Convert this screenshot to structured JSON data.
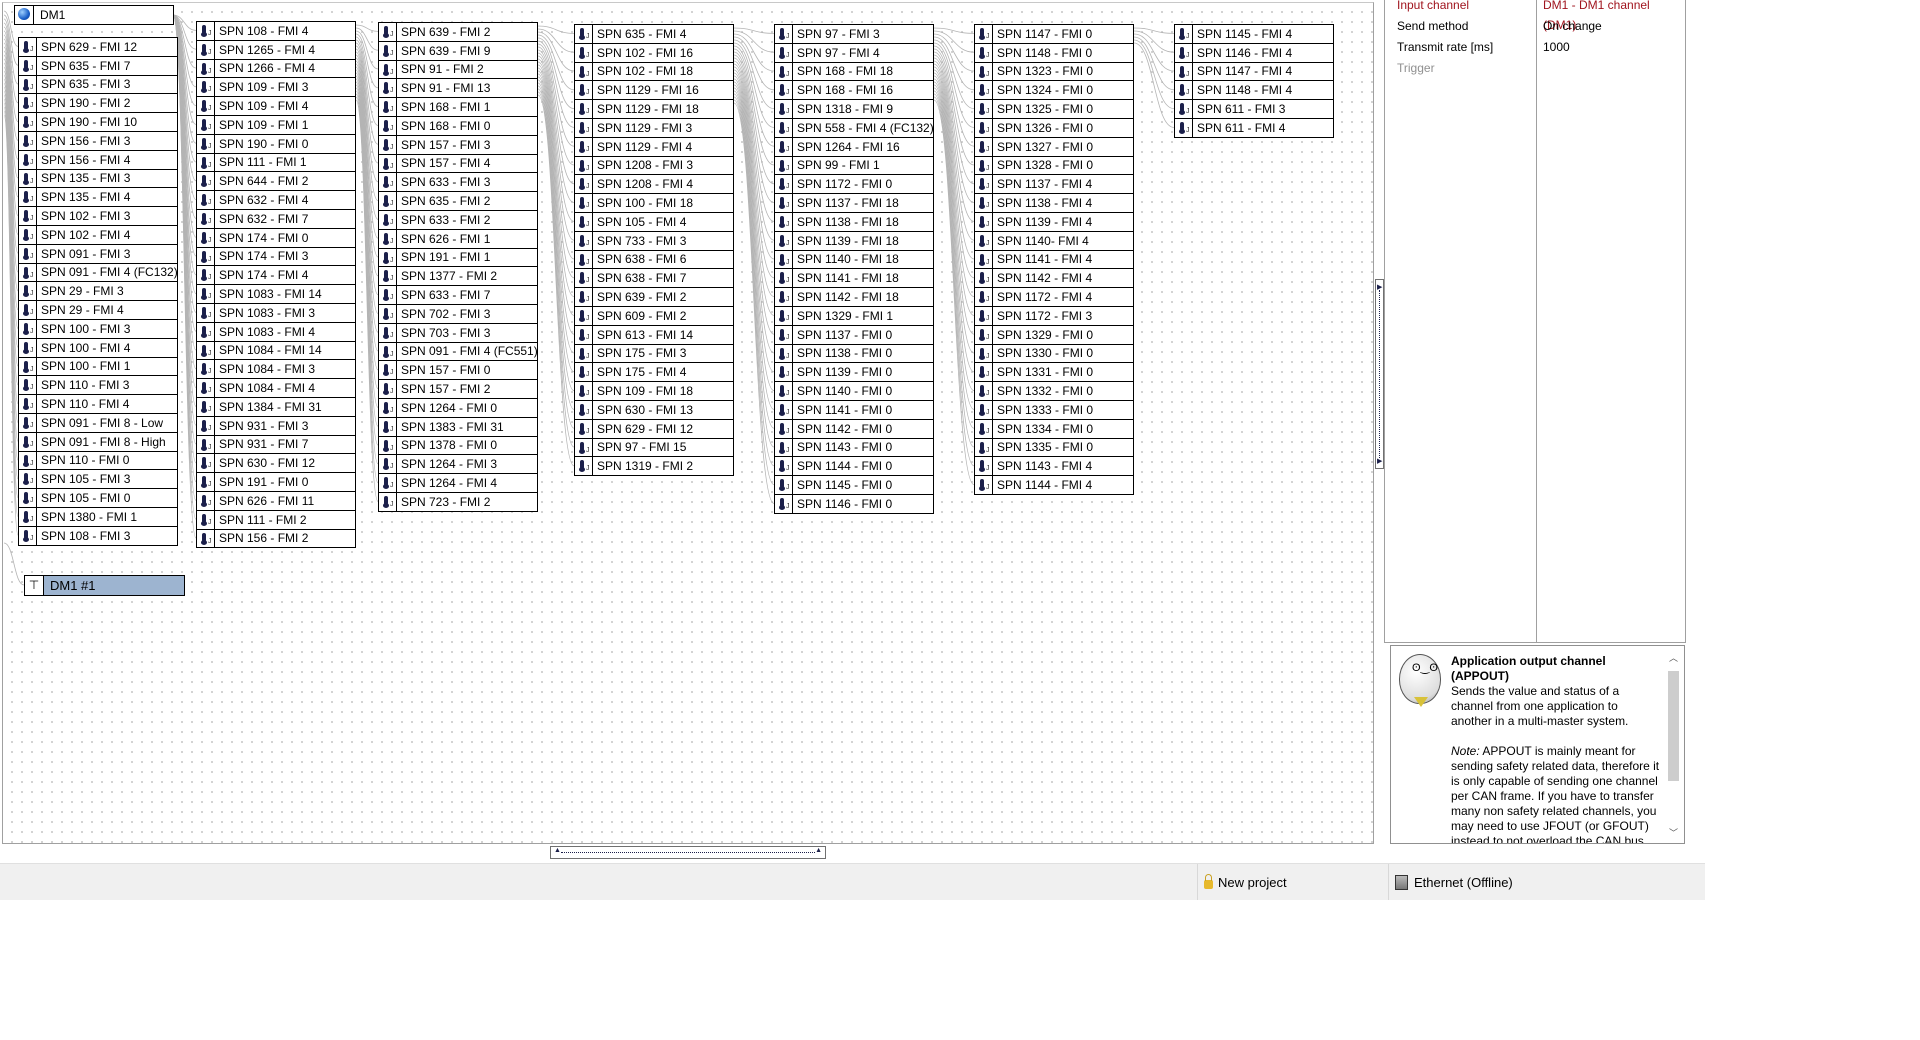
{
  "source_node": {
    "label": "DM1",
    "icon": "globe-icon"
  },
  "output_node": {
    "label": "DM1 #1",
    "icon": "output-icon"
  },
  "item_icon": "thermometer-icon",
  "columns": [
    [
      "SPN 629 - FMI 12",
      "SPN 635 - FMI 7",
      "SPN 635 - FMI 3",
      "SPN 190 - FMI 2",
      "SPN 190 - FMI 10",
      "SPN 156 - FMI 3",
      "SPN 156 - FMI 4",
      "SPN 135 - FMI 3",
      "SPN 135 - FMI 4",
      "SPN 102 - FMI 3",
      "SPN 102 - FMI 4",
      "SPN 091 - FMI 3",
      "SPN 091 - FMI 4 (FC132)",
      "SPN 29 - FMI 3",
      "SPN 29 - FMI 4",
      "SPN 100 - FMI 3",
      "SPN 100 - FMI 4",
      "SPN 100 - FMI 1",
      "SPN 110 - FMI 3",
      "SPN 110 - FMI 4",
      "SPN 091 - FMI 8 - Low",
      "SPN 091 - FMI 8 - High",
      "SPN 110 - FMI 0",
      "SPN 105 - FMI 3",
      "SPN 105 - FMI 0",
      "SPN 1380 - FMI 1",
      "SPN 108 - FMI 3"
    ],
    [
      "SPN 108 - FMI 4",
      "SPN 1265 - FMI 4",
      "SPN 1266 - FMI 4",
      "SPN 109 - FMI 3",
      "SPN 109 - FMI 4",
      "SPN 109 - FMI 1",
      "SPN 190 - FMI 0",
      "SPN 111 - FMI 1",
      "SPN 644 - FMI 2",
      "SPN 632 - FMI 4",
      "SPN 632 - FMI 7",
      "SPN 174 - FMI 0",
      "SPN 174 - FMI 3",
      "SPN 174 - FMI 4",
      "SPN 1083 - FMI 14",
      "SPN 1083 - FMI 3",
      "SPN 1083 - FMI 4",
      "SPN 1084 - FMI 14",
      "SPN 1084 - FMI 3",
      "SPN 1084 - FMI 4",
      "SPN 1384 - FMI 31",
      "SPN 931 - FMI 3",
      "SPN 931 - FMI 7",
      "SPN 630 - FMI 12",
      "SPN 191 - FMI 0",
      "SPN 626 - FMI 11",
      "SPN 111 - FMI 2",
      "SPN 156 - FMI 2"
    ],
    [
      "SPN 639 - FMI 2",
      "SPN 639 - FMI 9",
      "SPN 91 - FMI 2",
      "SPN 91 - FMI 13",
      "SPN 168 - FMI 1",
      "SPN 168 - FMI 0",
      "SPN 157 - FMI 3",
      "SPN 157 - FMI 4",
      "SPN 633 - FMI 3",
      "SPN 635 - FMI 2",
      "SPN 633 - FMI 2",
      "SPN 626 - FMI 1",
      "SPN 191 - FMI 1",
      "SPN 1377 - FMI 2",
      "SPN 633 - FMI 7",
      "SPN 702 - FMI 3",
      "SPN 703 - FMI 3",
      "SPN 091 - FMI 4 (FC551)",
      "SPN 157 - FMI 0",
      "SPN 157 - FMI 2",
      "SPN 1264 - FMI 0",
      "SPN 1383 - FMI 31",
      "SPN 1378 - FMI 0",
      "SPN 1264 - FMI 3",
      "SPN 1264 - FMI 4",
      "SPN 723 - FMI 2"
    ],
    [
      "SPN 635 - FMI 4",
      "SPN 102 - FMI 16",
      "SPN 102 - FMI 18",
      "SPN 1129 - FMI 16",
      "SPN 1129 - FMI 18",
      "SPN 1129 - FMI 3",
      "SPN 1129 - FMI 4",
      "SPN 1208 - FMI 3",
      "SPN 1208 - FMI 4",
      "SPN 100 - FMI 18",
      "SPN 105 - FMI 4",
      "SPN 733 - FMI 3",
      "SPN 638 - FMI 6",
      "SPN 638 - FMI 7",
      "SPN 639 - FMI 2",
      "SPN 609 - FMI 2",
      "SPN 613 - FMI 14",
      "SPN 175 - FMI 3",
      "SPN 175 - FMI 4",
      "SPN 109 - FMI 18",
      "SPN 630 - FMI 13",
      "SPN 629 - FMI 12",
      "SPN 97 - FMI 15",
      "SPN 1319 - FMI 2"
    ],
    [
      "SPN 97 - FMI 3",
      "SPN 97 - FMI 4",
      "SPN 168 - FMI 18",
      "SPN 168 - FMI 16",
      "SPN 1318 - FMI 9",
      "SPN 558 - FMI 4 (FC132)",
      "SPN 1264 - FMI 16",
      "SPN 99 - FMI 1",
      "SPN 1172 - FMI 0",
      "SPN 1137 - FMI 18",
      "SPN 1138 - FMI 18",
      "SPN 1139 - FMI 18",
      "SPN 1140 - FMI 18",
      "SPN 1141 - FMI 18",
      "SPN 1142 - FMI 18",
      "SPN 1329 - FMI 1",
      "SPN 1137 - FMI 0",
      "SPN 1138 - FMI 0",
      "SPN 1139 - FMI 0",
      "SPN 1140 - FMI 0",
      "SPN 1141 - FMI 0",
      "SPN 1142 - FMI 0",
      "SPN 1143 - FMI 0",
      "SPN 1144 - FMI 0",
      "SPN 1145 - FMI 0",
      "SPN 1146 - FMI 0"
    ],
    [
      "SPN 1147 - FMI 0",
      "SPN 1148 - FMI 0",
      "SPN 1323 - FMI 0",
      "SPN 1324 - FMI 0",
      "SPN 1325 - FMI 0",
      "SPN 1326 - FMI 0",
      "SPN 1327 - FMI 0",
      "SPN 1328 - FMI 0",
      "SPN 1137 - FMI 4",
      "SPN 1138 - FMI 4",
      "SPN 1139 - FMI 4",
      "SPN 1140- FMI 4",
      "SPN 1141 - FMI 4",
      "SPN 1142 - FMI 4",
      "SPN 1172 - FMI 4",
      "SPN 1172 - FMI 3",
      "SPN 1329 - FMI 0",
      "SPN 1330 - FMI 0",
      "SPN 1331 - FMI 0",
      "SPN 1332 - FMI 0",
      "SPN 1333 - FMI 0",
      "SPN 1334 - FMI 0",
      "SPN 1335 - FMI 0",
      "SPN 1143 - FMI 4",
      "SPN 1144 - FMI 4"
    ],
    [
      "SPN 1145 - FMI 4",
      "SPN 1146 - FMI 4",
      "SPN 1147 - FMI 4",
      "SPN 1148 - FMI 4",
      "SPN 611 - FMI 3",
      "SPN 611 - FMI 4"
    ]
  ],
  "properties": [
    {
      "key": "Input channel",
      "value": "DM1 - DM1 channel (DM1)",
      "state": "error"
    },
    {
      "key": "Send method",
      "value": "On change",
      "state": "normal"
    },
    {
      "key": "Transmit rate [ms]",
      "value": "1000",
      "state": "normal"
    },
    {
      "key": "Trigger",
      "value": "",
      "state": "disabled"
    }
  ],
  "help": {
    "title": "Application output channel (APPOUT)",
    "body": "Sends the value and status of a channel from one application to another in a multi-master system.",
    "note_label": "Note:",
    "note": " APPOUT is mainly meant for sending safety related data, therefore it is only capable of sending one channel per CAN frame. If you have to transfer many non safety related channels, you may need to use JFOUT (or GFOUT) instead to not overload the CAN bus. That way you can package multiple"
  },
  "status": {
    "project": "New project",
    "connection": "Ethernet (Offline)"
  },
  "colors": {
    "error_text": "#a0141e",
    "selected_node": "#9db4d0",
    "wire": "#b4b4b4"
  }
}
